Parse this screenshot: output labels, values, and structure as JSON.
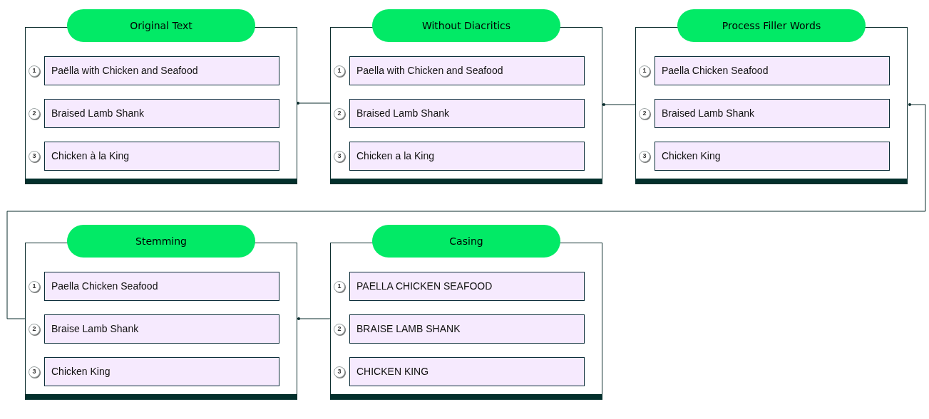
{
  "stages": [
    {
      "title": "Original Text",
      "items": [
        {
          "number": "1",
          "text": "Paëlla with Chicken and Seafood"
        },
        {
          "number": "2",
          "text": "Braised Lamb Shank"
        },
        {
          "number": "3",
          "text": "Chicken à la King"
        }
      ]
    },
    {
      "title": "Without Diacritics",
      "items": [
        {
          "number": "1",
          "text": "Paella with Chicken and Seafood"
        },
        {
          "number": "2",
          "text": "Braised Lamb Shank"
        },
        {
          "number": "3",
          "text": "Chicken a la King"
        }
      ]
    },
    {
      "title": "Process Filler Words",
      "items": [
        {
          "number": "1",
          "text": "Paella Chicken Seafood"
        },
        {
          "number": "2",
          "text": "Braised Lamb Shank"
        },
        {
          "number": "3",
          "text": "Chicken King"
        }
      ]
    },
    {
      "title": "Stemming",
      "items": [
        {
          "number": "1",
          "text": "Paella Chicken Seafood"
        },
        {
          "number": "2",
          "text": "Braise Lamb Shank"
        },
        {
          "number": "3",
          "text": "Chicken King"
        }
      ]
    },
    {
      "title": "Casing",
      "items": [
        {
          "number": "1",
          "text": "PAELLA CHICKEN SEAFOOD"
        },
        {
          "number": "2",
          "text": "BRAISE LAMB SHANK"
        },
        {
          "number": "3",
          "text": "CHICKEN KING"
        }
      ]
    }
  ]
}
